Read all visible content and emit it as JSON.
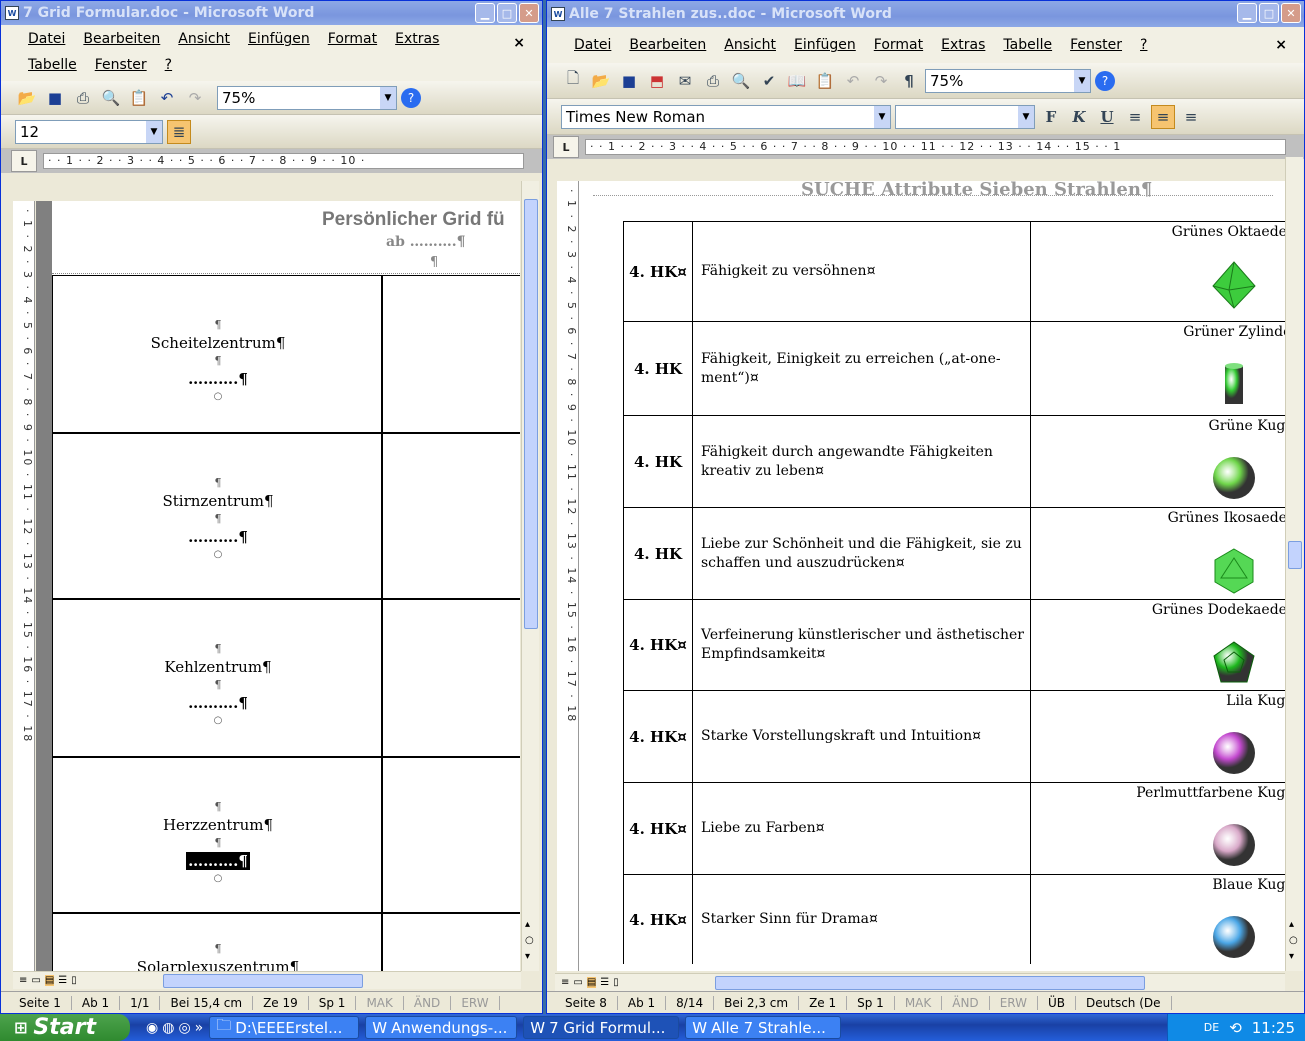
{
  "left_window": {
    "title": "7 Grid Formular.doc - Microsoft Word",
    "menu": [
      "Datei",
      "Bearbeiten",
      "Ansicht",
      "Einfügen",
      "Format",
      "Extras",
      "Tabelle",
      "Fenster",
      "?"
    ],
    "zoom": "75%",
    "font_size": "12",
    "ruler": "· · 1 · · 2 · · 3 · · 4 · · 5 · · 6 · · 7 · · 8 · · 9 · · 10 ·",
    "vruler": "· 1 · 2 · 3 · 4 · 5 · 6 · 7 · 8 · 9 · 10 · 11 · 12 · 13 · 14 · 15 · 16 · 17 · 18",
    "doc_title": "Persönlicher Grid fü",
    "doc_subtitle": "ab ……….¶",
    "pilcrow": "¶",
    "rows": [
      {
        "label": "Scheitelzentrum¶",
        "dots": "……….¶"
      },
      {
        "label": "Stirnzentrum¶",
        "dots": "……….¶"
      },
      {
        "label": "Kehlzentrum¶",
        "dots": "……….¶"
      },
      {
        "label": "Herzzentrum¶",
        "dots": "……….¶"
      },
      {
        "label": "Solarplexuszentrum¶",
        "dots": ""
      }
    ],
    "status": {
      "seite": "Seite 1",
      "ab": "Ab 1",
      "pages": "1/1",
      "bei": "Bei 15,4 cm",
      "ze": "Ze 19",
      "sp": "Sp 1",
      "mak": "MAK",
      "aend": "ÄND",
      "erw": "ERW"
    }
  },
  "right_window": {
    "title": "Alle 7 Strahlen zus..doc - Microsoft Word",
    "menu": [
      "Datei",
      "Bearbeiten",
      "Ansicht",
      "Einfügen",
      "Format",
      "Extras",
      "Tabelle",
      "Fenster",
      "?"
    ],
    "zoom": "75%",
    "font": "Times New Roman",
    "format_buttons": [
      "F",
      "K",
      "U"
    ],
    "ruler": "· · 1 · · 2 · · 3 · · 4 · · 5 · · 6 · · 7 · · 8 · · 9 · · 10 · · 11 · · 12 · · 13 · · 14 · · 15 · · 1",
    "vruler": "· 1 · 2 · 3 · 4 · 5 · 6 · 7 · 8 · 9 · 10 · 11 · 12 · 13 · 14 · 15 · 16 · 17 · 18",
    "doc_heading": "SUCHE Attribute Sieben Strahlen¶",
    "rows": [
      {
        "hk": "4. HK¤",
        "text": "Fähigkeit zu versöhnen¤",
        "shape_label": "Grünes  Oktaeder  ¶",
        "shape": "octahedron",
        "color": "#3dcc3d"
      },
      {
        "hk": "4. HK",
        "text": "Fähigkeit, Einigkeit zu erreichen („at-one-ment“)¤",
        "shape_label": "Grüner  Zylinder¶",
        "shape": "cylinder",
        "color": "#33cc33"
      },
      {
        "hk": "4. HK",
        "text": "Fähigkeit durch angewandte Fähigkeiten kreativ zu leben¤",
        "shape_label": "Grüne Kugel¶",
        "shape": "sphere",
        "color": "#6fd64a"
      },
      {
        "hk": "4. HK",
        "text": "Liebe zur Schönheit und die Fähigkeit, sie zu schaffen und auszudrücken¤",
        "shape_label": "Grünes  Ikosaeder ¶",
        "shape": "icosahedron",
        "color": "#55d855"
      },
      {
        "hk": "4. HK¤",
        "text": "Verfeinerung künstlerischer und ästhetischer Empfindsamkeit¤",
        "shape_label": "Grünes  Dodekaeder ¶",
        "shape": "dodecahedron",
        "color": "#1db81d"
      },
      {
        "hk": "4. HK¤",
        "text": "Starke Vorstellungskraft und Intuition¤",
        "shape_label": "Lila Kugel¶",
        "shape": "sphere",
        "color": "#c44ad0"
      },
      {
        "hk": "4. HK¤",
        "text": "Liebe zu Farben¤",
        "shape_label": "Perlmuttfarbene Kugel¶",
        "shape": "sphere",
        "color": "#d8a8c8"
      },
      {
        "hk": "4. HK¤",
        "text": "Starker Sinn für Drama¤",
        "shape_label": "Blaue Kugel¶",
        "shape": "sphere",
        "color": "#4aa6e6"
      }
    ],
    "status": {
      "seite": "Seite 8",
      "ab": "Ab 1",
      "pages": "8/14",
      "bei": "Bei 2,3 cm",
      "ze": "Ze 1",
      "sp": "Sp 1",
      "mak": "MAK",
      "aend": "ÄND",
      "erw": "ERW",
      "ueb": "ÜB",
      "lang": "Deutsch (De"
    }
  },
  "taskbar": {
    "start": "Start",
    "tasks": [
      "D:\\EEEErstel...",
      "Anwendungs-...",
      "7 Grid Formul...",
      "Alle 7 Strahle..."
    ],
    "lang": "DE",
    "clock": "11:25"
  }
}
